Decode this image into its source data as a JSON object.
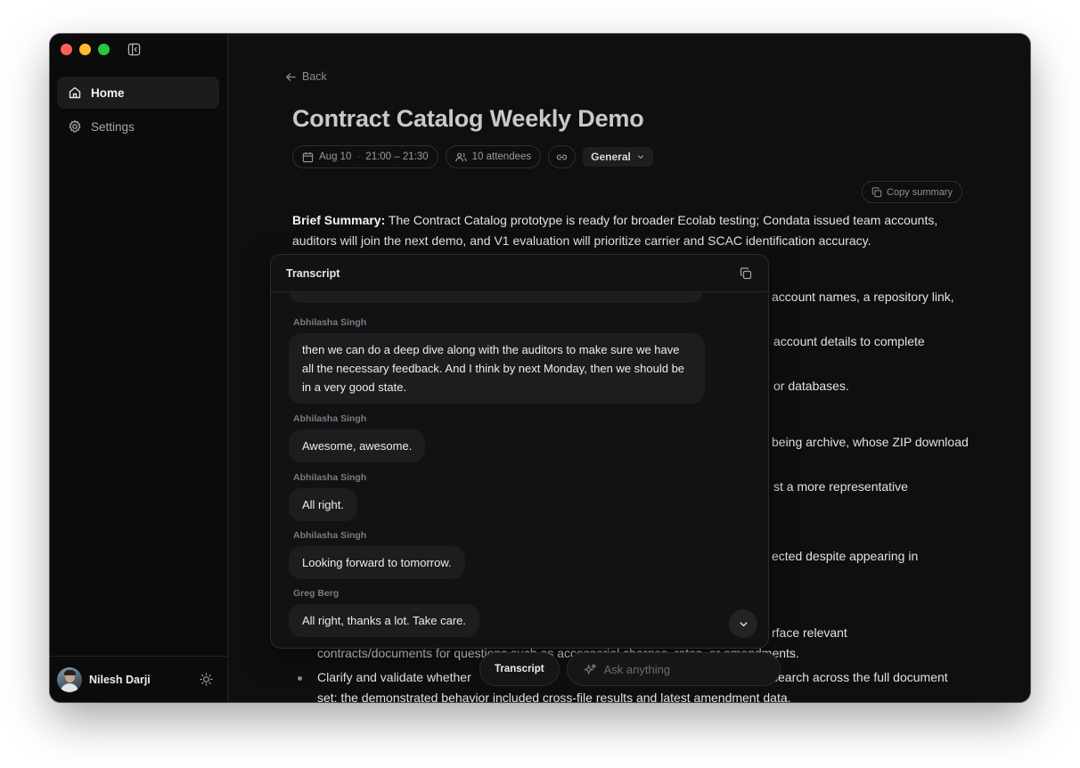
{
  "sidebar": {
    "items": [
      {
        "label": "Home",
        "icon": "home-icon"
      },
      {
        "label": "Settings",
        "icon": "gear-icon"
      }
    ],
    "user": {
      "name": "Nilesh Darji"
    }
  },
  "meeting": {
    "back_label": "Back",
    "title": "Contract Catalog Weekly Demo",
    "date": "Aug 10",
    "time": "21:00 – 21:30",
    "attendees": "10 attendees",
    "category": "General",
    "copy_summary_label": "Copy summary",
    "brief_label": "Brief Summary:",
    "brief_text": " The Contract Catalog prototype is ready for broader Ecolab testing; Condata issued team accounts, auditors will join the next demo, and V1 evaluation will prioritize carrier and SCAC identification accuracy.",
    "partial_lines": [
      "account names, a repository link,",
      "account details to complete",
      "or databases.",
      "being archive, whose ZIP download",
      "st a more representative",
      "ected despite appearing in",
      "rface relevant",
      "contracts/documents for questions such as accessorial charges, rates, or amendments.",
      "Clarify and validate whether",
      "search across the full document",
      "set; the demonstrated behavior included cross-file results and latest amendment data."
    ]
  },
  "transcript": {
    "title": "Transcript",
    "messages": [
      {
        "speaker": "Abhilasha Singh",
        "text": "then we can do a deep dive along with the auditors to make sure we have all the necessary feedback. And I think by next Monday, then we should be in a very good state."
      },
      {
        "speaker": "Abhilasha Singh",
        "text": "Awesome, awesome."
      },
      {
        "speaker": "Abhilasha Singh",
        "text": "All right."
      },
      {
        "speaker": "Abhilasha Singh",
        "text": "Looking forward to tomorrow."
      },
      {
        "speaker": "Greg Berg",
        "text": "All right, thanks a lot. Take care."
      }
    ]
  },
  "bottom_bar": {
    "transcript_label": "Transcript",
    "ask_placeholder": "Ask anything"
  }
}
